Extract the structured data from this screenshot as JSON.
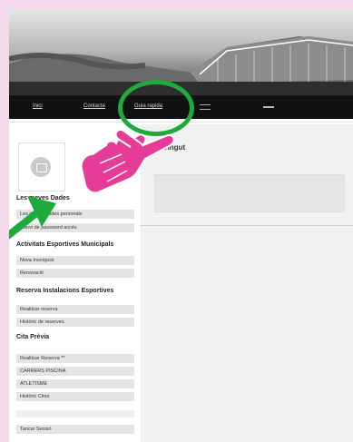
{
  "nav": {
    "inici": "Inici",
    "contacte": "Contacte",
    "guia": "Guia rapida"
  },
  "main": {
    "welcome": "Benvingut"
  },
  "sidebar": {
    "section1": {
      "title": "Les meves Dades",
      "items": [
        "Les meves dades personals",
        "Canvi de password accés"
      ]
    },
    "section2": {
      "title": "Activitats Esportives Municipals",
      "items": [
        "Nova Inscripció",
        "Renovació"
      ]
    },
    "section3": {
      "title": "Reserva Instalacions Esportives",
      "items": [
        "Realitzar reserva",
        "Històric de reserves"
      ]
    },
    "section4": {
      "title": "Cita Prèvia",
      "items": [
        "Realitzar Reserva **",
        "CARRERS PISCINA",
        "ATLETISME",
        "Històric Cites"
      ]
    },
    "logout": "Tancar Sessió"
  },
  "annotations": {
    "circle_color": "#1faa3c",
    "arrow_color": "#1faa3c",
    "hand_color": "#e63b97"
  }
}
